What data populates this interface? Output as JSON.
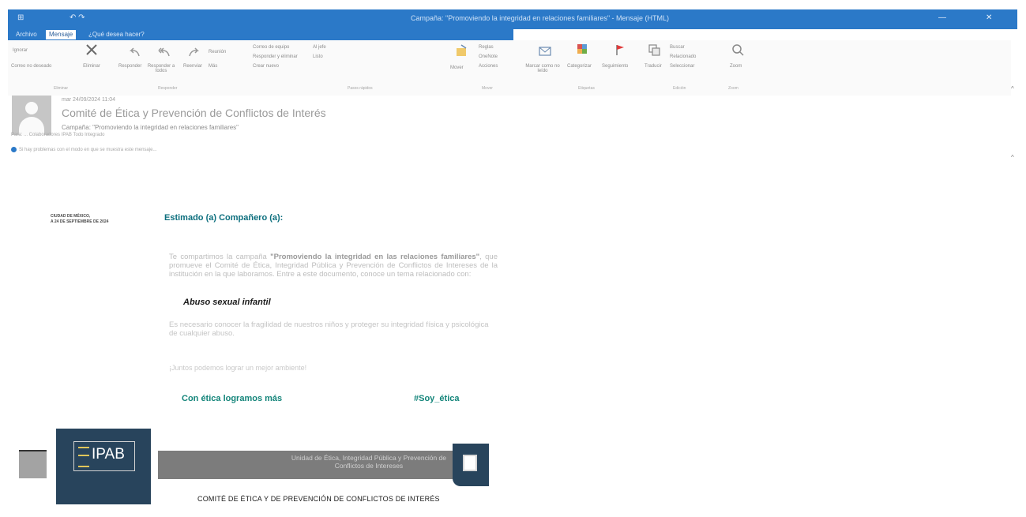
{
  "window": {
    "title": "Campaña: \"Promoviendo la integridad en relaciones familiares\" - Mensaje (HTML)",
    "quick_access": [
      "⊞",
      "↶ ↷"
    ],
    "controls": [
      "—",
      "✕"
    ]
  },
  "tabs": [
    {
      "label": "Archivo",
      "active": false
    },
    {
      "label": "Mensaje",
      "active": true
    },
    {
      "label": "¿Qué desea hacer?",
      "active": false
    }
  ],
  "ribbon": {
    "ignore": "Ignorar",
    "junk": "Correo no deseado",
    "delete": "Eliminar",
    "reply": "Responder",
    "reply_all": "Responder a todos",
    "forward": "Reenviar",
    "meeting": "Reunión",
    "more": "Más",
    "quick1": "Correo de equipo",
    "quick2": "Responder y eliminar",
    "quick3": "Crear nuevo",
    "quick4": "Al jefe",
    "quick5": "Listo",
    "move": "Mover",
    "rules": "Reglas",
    "onenote": "OneNote",
    "actions": "Acciones",
    "mark_unread": "Marcar como no leído",
    "categorize": "Categorizar",
    "follow_up": "Seguimiento",
    "translate": "Traducir",
    "search": "Buscar",
    "related": "Relacionado",
    "select": "Seleccionar",
    "zoom": "Zoom",
    "groups": {
      "delete": "Eliminar",
      "respond": "Responder",
      "quick_steps": "Pasos rápidos",
      "move": "Mover",
      "tags": "Etiquetas",
      "editing": "Edición",
      "zoom": "Zoom"
    }
  },
  "message": {
    "date": "mar 24/09/2024 11:04",
    "sender": "Comité de Ética y Prevención de Conflictos de Interés",
    "subject": "Campaña: \"Promoviendo la integridad en relaciones familiares\"",
    "to": "Para: ... Colaboradores IPAB Todo Integrado",
    "info": "Si hay problemas con el modo en que se muestra este mensaje..."
  },
  "body": {
    "place_line1": "CIUDAD DE MÉXICO,",
    "place_line2": "A 24 DE SEPTIEMBRE DE 2024",
    "greeting": "Estimado (a) Compañero (a):",
    "para1_pre": "Te compartimos la campaña ",
    "para1_bold": "\"Promoviendo la integridad en las relaciones familiares\"",
    "para1_post": ", que promueve el Comité de Ética, Integridad Pública y Prevención de Conflictos de Intereses de la institución en la que laboramos. Entre a este documento, conoce un tema relacionado con:",
    "highlight": "Abuso sexual infantil",
    "para2": "Es necesario conocer la fragilidad de nuestros niños y proteger su integridad física y psicológica de cualquier abuso.",
    "para3": "¡Juntos podemos lograr un mejor ambiente!",
    "slogan_left": "Con ética logramos más",
    "slogan_right": "#Soy_ética"
  },
  "banner": {
    "logo_text": "IPAB",
    "bar_line1": "Unidad de Ética, Integridad Pública y Prevención de",
    "bar_line2": "Conflictos de Intereses",
    "footer": "COMITÉ DE ÉTICA Y DE PREVENCIÓN DE CONFLICTOS DE INTERÉS"
  },
  "colors": {
    "accent": "#2b79c8",
    "teal": "#14857a",
    "navy": "#28445c"
  }
}
